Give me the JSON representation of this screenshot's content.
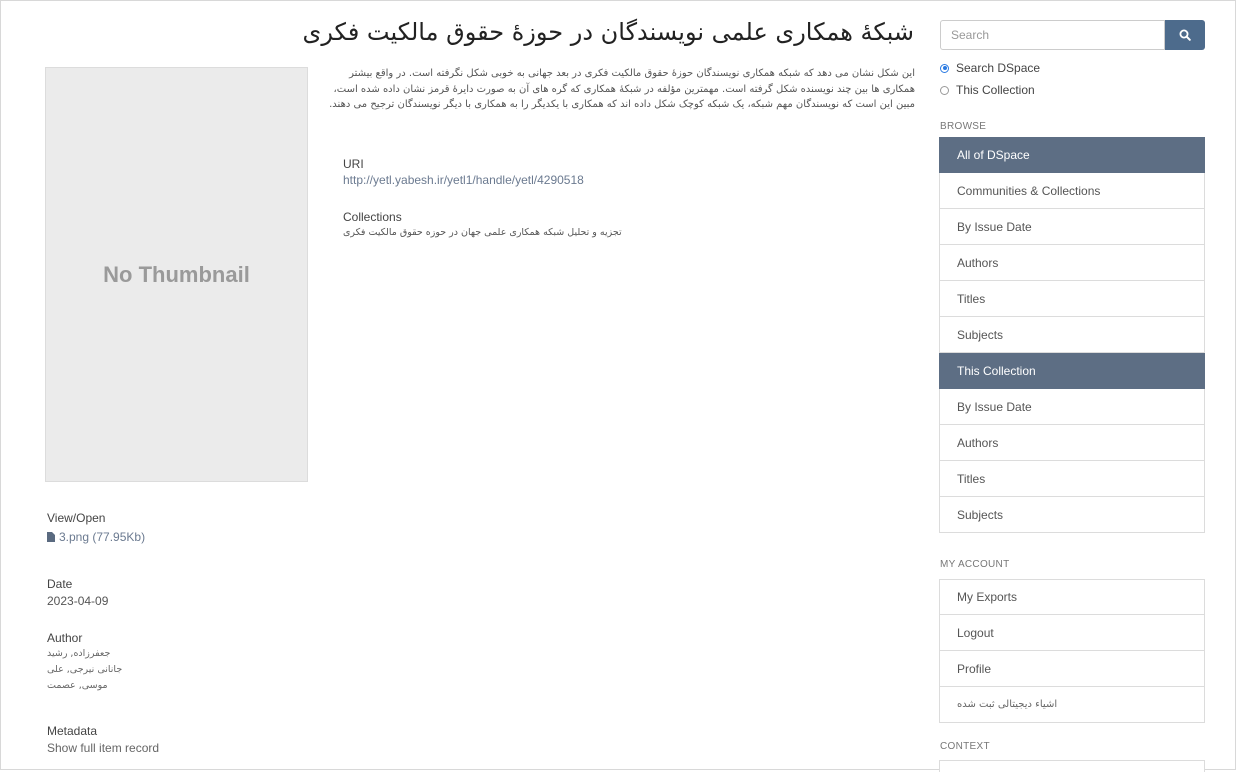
{
  "page": {
    "title": "شبکۀ همکاری علمی نویسندگان در حوزۀ حقوق مالکیت فکری",
    "thumbnail_text": "No Thumbnail",
    "abstract": "این شکل نشان می دهد که شبکه همکاری نویسندگان حوزۀ حقوق مالکیت فکری در بعد جهانی به خوبی شکل نگرفته است. در واقع بیشتر همکاری ها بین چند نویسنده شکل گرفته است. مهمترین مؤلفه در شبکۀ همکاری که گره های آن به صورت دایرۀ قرمز نشان داده شده است، مبین این است که نویسندگان مهم شبکه، یک شبکه کوچک شکل داده اند که همکاری با یکدیگر را به همکاری با دیگر نویسندگان ترجیح می دهند."
  },
  "uri": {
    "label": "URI",
    "value": "http://yetl.yabesh.ir/yetl1/handle/yetl/4290518"
  },
  "collections": {
    "label": "Collections",
    "value": "تجزیه و تحلیل شبکه همکاری علمی جهان در حوزه حقوق مالکیت فکری"
  },
  "view_open": {
    "label": "View/Open",
    "file": "3.png (77.95Kb)"
  },
  "date": {
    "label": "Date",
    "value": "2023-04-09"
  },
  "author": {
    "label": "Author",
    "names": [
      "جعفرزاده, رشید",
      "جانانی نیرجی, علی",
      "موسی, عصمت"
    ]
  },
  "metadata": {
    "label": "Metadata",
    "link": "Show full item record"
  },
  "sidebar": {
    "search_placeholder": "Search",
    "search_icon": "search-icon",
    "radio_dspace": "Search DSpace",
    "radio_collection": "This Collection",
    "browse_heading": "BROWSE",
    "browse_all": [
      "All of DSpace",
      "Communities & Collections",
      "By Issue Date",
      "Authors",
      "Titles",
      "Subjects"
    ],
    "browse_collection": [
      "This Collection",
      "By Issue Date",
      "Authors",
      "Titles",
      "Subjects"
    ],
    "account_heading": "MY ACCOUNT",
    "account_items": [
      "My Exports",
      "Logout",
      "Profile",
      "اشیاء دیجیتالی ثبت شده"
    ],
    "context_heading": "CONTEXT"
  },
  "colors": {
    "accent": "#4d6b8c",
    "active_item": "#5d6e84"
  }
}
